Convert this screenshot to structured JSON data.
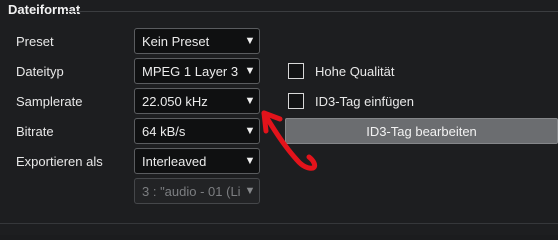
{
  "section": {
    "title": "Dateiformat"
  },
  "rows": [
    {
      "label": "Preset",
      "value": "Kein Preset"
    },
    {
      "label": "Dateityp",
      "value": "MPEG 1 Layer 3"
    },
    {
      "label": "Samplerate",
      "value": "22.050 kHz"
    },
    {
      "label": "Bitrate",
      "value": "64 kB/s"
    },
    {
      "label": "Exportieren als",
      "value": "Interleaved"
    }
  ],
  "channel_select": {
    "value": "3 : \"audio - 01 (Li."
  },
  "dropdown_arrow": "▼",
  "options": {
    "high_quality": {
      "label": "Hohe Qualität",
      "checked": false
    },
    "id3_insert": {
      "label": "ID3-Tag einfügen",
      "checked": false
    }
  },
  "id3_button": {
    "label": "ID3-Tag bearbeiten"
  },
  "colors": {
    "annotation_arrow": "#e3131b",
    "button_bg": "#6b6d70"
  }
}
